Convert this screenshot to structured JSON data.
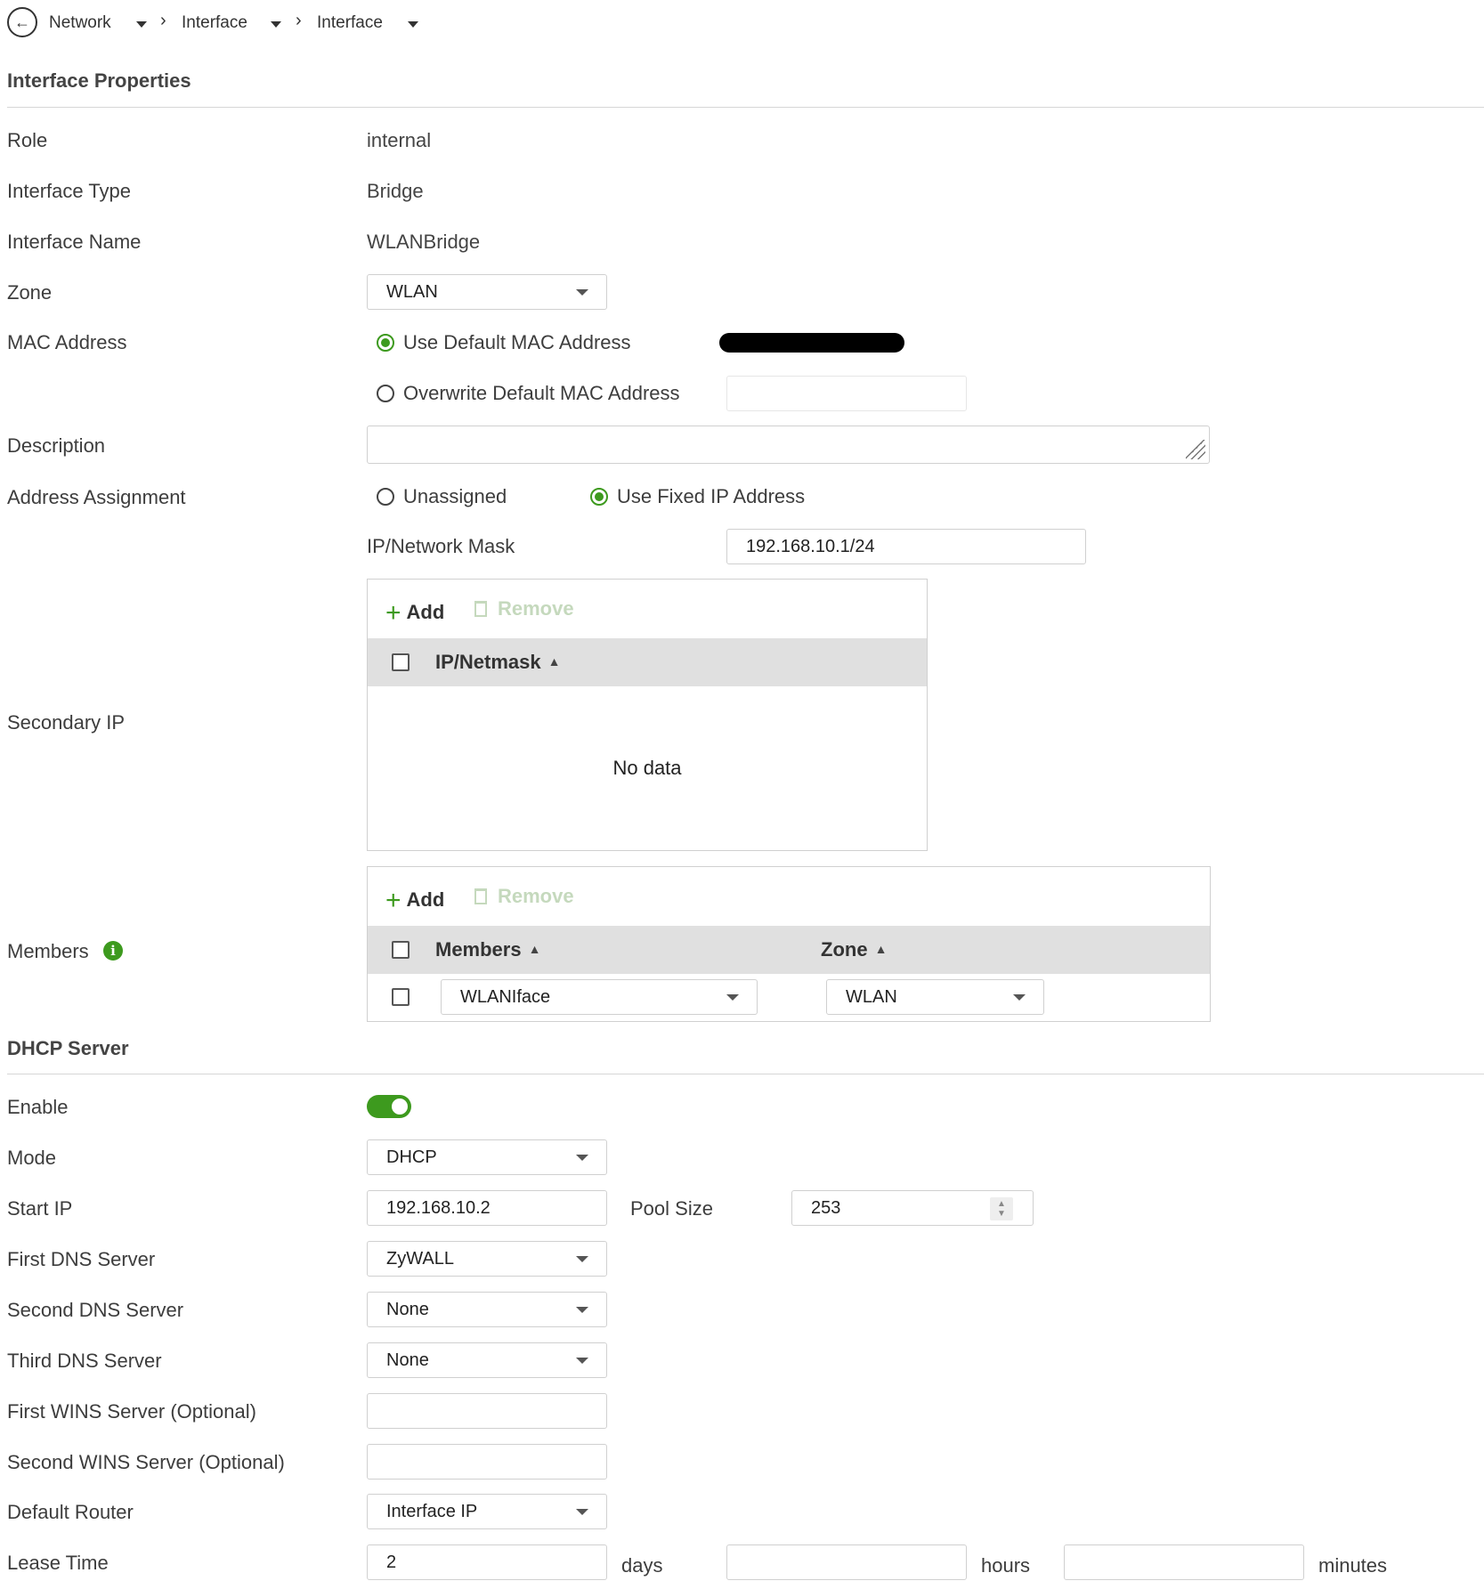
{
  "breadcrumb": {
    "items": [
      "Network",
      "Interface",
      "Interface"
    ]
  },
  "interface_properties": {
    "title": "Interface Properties",
    "role_label": "Role",
    "role_value": "internal",
    "type_label": "Interface Type",
    "type_value": "Bridge",
    "name_label": "Interface Name",
    "name_value": "WLANBridge",
    "zone_label": "Zone",
    "zone_value": "WLAN",
    "mac_label": "MAC Address",
    "mac_default_label": "Use Default MAC Address",
    "mac_overwrite_label": "Overwrite Default MAC Address",
    "mac_overwrite_value": "",
    "description_label": "Description",
    "description_value": "",
    "address_label": "Address Assignment",
    "unassigned_label": "Unassigned",
    "fixed_ip_label": "Use Fixed IP Address",
    "ip_mask_label": "IP/Network Mask",
    "ip_mask_value": "192.168.10.1/24",
    "secondary_ip_label": "Secondary IP",
    "members_label": "Members"
  },
  "secondary_ip_table": {
    "add_label": "Add",
    "remove_label": "Remove",
    "column": "IP/Netmask",
    "empty_text": "No data"
  },
  "members_table": {
    "add_label": "Add",
    "remove_label": "Remove",
    "columns": [
      "Members",
      "Zone"
    ],
    "rows": [
      {
        "member": "WLANIface",
        "zone": "WLAN"
      }
    ]
  },
  "dhcp": {
    "title": "DHCP Server",
    "enable_label": "Enable",
    "enabled": true,
    "mode_label": "Mode",
    "mode_value": "DHCP",
    "start_ip_label": "Start IP",
    "start_ip_value": "192.168.10.2",
    "pool_size_label": "Pool Size",
    "pool_size_value": "253",
    "dns1_label": "First DNS Server",
    "dns1_value": "ZyWALL",
    "dns2_label": "Second DNS Server",
    "dns2_value": "None",
    "dns3_label": "Third DNS Server",
    "dns3_value": "None",
    "wins1_label": "First WINS Server (Optional)",
    "wins1_value": "",
    "wins2_label": "Second WINS Server (Optional)",
    "wins2_value": "",
    "router_label": "Default Router",
    "router_value": "Interface IP",
    "lease_label": "Lease Time",
    "lease_days_value": "2",
    "lease_days_unit": "days",
    "lease_hours_value": "",
    "lease_hours_unit": "hours",
    "lease_minutes_value": "",
    "lease_minutes_unit": "minutes"
  },
  "colors": {
    "accent_green": "#3d9a1e",
    "header_gray": "#e0e0e0"
  }
}
